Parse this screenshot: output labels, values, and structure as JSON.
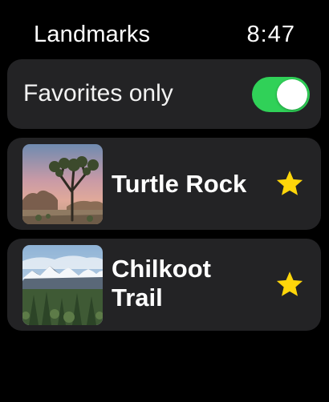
{
  "header": {
    "title": "Landmarks",
    "time": "8:47"
  },
  "filter": {
    "label": "Favorites only",
    "enabled": true
  },
  "colors": {
    "toggle_on": "#30d158",
    "star": "#ffd60a",
    "card_bg": "#232325"
  },
  "landmarks": [
    {
      "name": "Turtle Rock",
      "favorite": true,
      "icon": "star-filled-icon"
    },
    {
      "name": "Chilkoot Trail",
      "favorite": true,
      "icon": "star-filled-icon"
    }
  ]
}
